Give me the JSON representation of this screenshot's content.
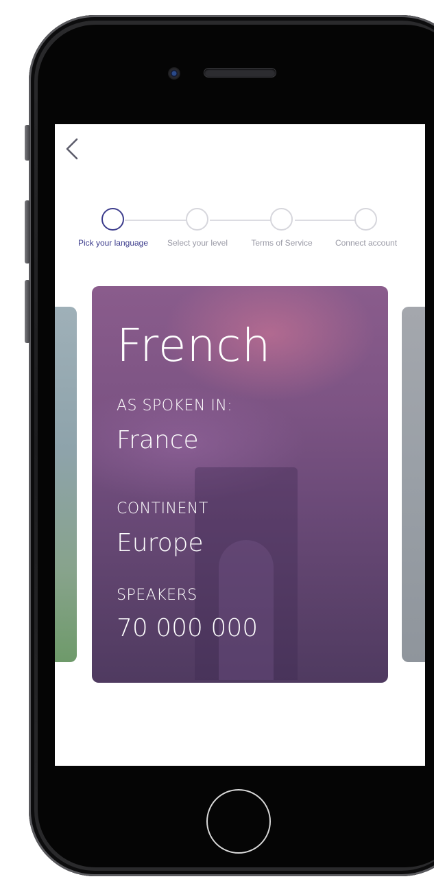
{
  "device": {
    "frame_color": "#1f1f21",
    "home_button_icon": "home-button-ring"
  },
  "screen": {
    "back_icon": "chevron-left-icon",
    "stepper": {
      "active_color": "#3c3c8c",
      "inactive_color": "#d6d6dc",
      "steps": [
        {
          "label": "Pick your language",
          "active": true
        },
        {
          "label": "Select your level",
          "active": false
        },
        {
          "label": "Terms of Service",
          "active": false
        },
        {
          "label": "Connect account",
          "active": false
        }
      ]
    },
    "card": {
      "language": "French",
      "spoken_in_label": "AS SPOKEN IN:",
      "spoken_in_value": "France",
      "continent_label": "CONTINENT",
      "continent_value": "Europe",
      "speakers_label": "SPEAKERS",
      "speakers_value": "70 000 000",
      "overlay_color": "#6b4a78"
    }
  }
}
